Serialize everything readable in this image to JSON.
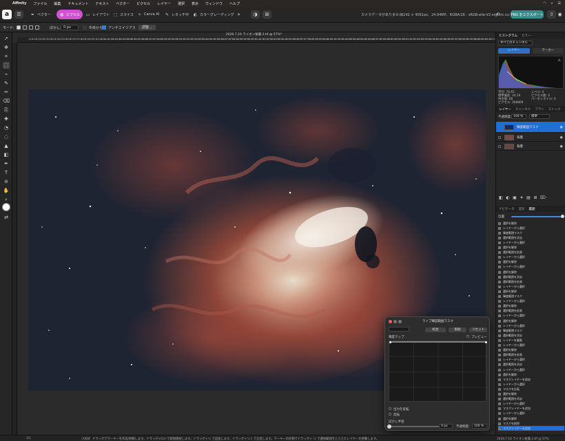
{
  "menubar": {
    "app": "Affinity",
    "items": [
      "ファイル",
      "編集",
      "ドキュメント",
      "テキスト",
      "ベクター",
      "ピクセル",
      "レイヤー",
      "選択",
      "表示",
      "ウィンドウ",
      "ヘルプ"
    ]
  },
  "toolbar": {
    "personas": [
      "ベクター",
      "ピクセル",
      "レイアウト",
      "スライス",
      "Canva AI",
      "レタッチ中",
      "カラーグレーディング"
    ],
    "camera_info": "カメラデータがありません",
    "image_info": "6142 × 4061px、24.94MP、RGBA/16 - sRGB-elle-V2-srgbtrc.icc",
    "export_label": "PNG をエクスポート"
  },
  "context": {
    "mode_label": "モード:",
    "blur_label": "ぼかし:",
    "blur_value": "0 px",
    "center_label": "中央から",
    "antialias_label": "アンチエイリアス",
    "refine_label": "調整..."
  },
  "document": {
    "title": "2026.7.10 ライオン秘書.2.tif @ 57%*"
  },
  "ruler_ticks": [
    "100",
    "150",
    "200",
    "250",
    "300",
    "350",
    "400",
    "450",
    "500",
    "550",
    "600",
    "650",
    "700",
    "750",
    "800",
    "850",
    "900",
    "950",
    "1000",
    "1050",
    "1100",
    "1150",
    "1200",
    "1250",
    "1300",
    "1350",
    "1400",
    "1450",
    "1500",
    "1550",
    "1600",
    "1650",
    "1700",
    "1750",
    "1800",
    "1850",
    "1900",
    "1950",
    "2000",
    "2050",
    "2100",
    "2150",
    "2200",
    "2250",
    "2300",
    "2350",
    "2400",
    "2450",
    "2500",
    "2550",
    "2600",
    "2650",
    "2700",
    "2750",
    "2800",
    "2850",
    "2900",
    "2950",
    "3000",
    "3050",
    "3100",
    "3150",
    "3200",
    "3250",
    "3300",
    "3350",
    "3400",
    "3450",
    "3500",
    "3550",
    "3600",
    "3650",
    "3700",
    "3750",
    "3800",
    "3850",
    "3900",
    "3950",
    "4000",
    "4050",
    "4100",
    "4150",
    "4200",
    "4250",
    "4300",
    "4350",
    "4400",
    "4450",
    "4500",
    "4550",
    "4600",
    "4650",
    "4700",
    "4750",
    "4800",
    "4850",
    "4900",
    "4950",
    "5000",
    "5050",
    "5100",
    "5150",
    "5200",
    "5250",
    "5300",
    "5350",
    "5400",
    "5450",
    "5500",
    "5550",
    "5600",
    "5650",
    "5700",
    "5750",
    "5800",
    "5850",
    "5900",
    "5950",
    "6000",
    "6050",
    "6100",
    "6150",
    "6200"
  ],
  "histogram_panel": {
    "tabs": [
      "ヒストグラム",
      "カラー"
    ],
    "channel_select": "すべてのチャンネル",
    "subtabs": [
      "レイヤー",
      "マーカー"
    ],
    "stats": {
      "mean_label": "平均:",
      "mean": "79.65",
      "stddev_label": "標準偏差:",
      "stddev": "34.29",
      "median_label": "中央値:",
      "median": "68",
      "pixels_label": "ピクセル:",
      "pixels": "368869",
      "level_label": "レベル:",
      "level": "0",
      "count_label": "ピクセル数:",
      "count": "0",
      "percentile_label": "パーセンタイル:",
      "percentile": "0"
    }
  },
  "layers_panel": {
    "tabs": [
      "レイヤー",
      "チャンネル",
      "ブラシ",
      "ストック"
    ],
    "opacity_label": "不透明度:",
    "opacity": "100 %",
    "blend": "標準",
    "layers": [
      {
        "name": "輝度範囲マスク",
        "selected": true
      },
      {
        "name": "背景",
        "selected": false
      },
      {
        "name": "背景",
        "selected": false
      }
    ]
  },
  "history_panel": {
    "tabs": [
      "ナビゲータ",
      "変形",
      "履歴"
    ],
    "position_label": "位置:",
    "items": [
      {
        "label": "選択を解除",
        "selected": false
      },
      {
        "label": "レイヤーから選択",
        "selected": false
      },
      {
        "label": "輝度範囲マスク",
        "selected": false
      },
      {
        "label": "選択範囲を消去",
        "selected": false
      },
      {
        "label": "レイヤーから選択",
        "selected": false
      },
      {
        "label": "選択を解除",
        "selected": false
      },
      {
        "label": "選択範囲を拡張",
        "selected": false
      },
      {
        "label": "レイヤーから選択",
        "selected": false
      },
      {
        "label": "選択を解除",
        "selected": false
      },
      {
        "label": "レイヤーから選択",
        "selected": false
      },
      {
        "label": "選択を解除",
        "selected": false
      },
      {
        "label": "選択範囲を消去",
        "selected": false
      },
      {
        "label": "選択範囲を拡張",
        "selected": false
      },
      {
        "label": "レイヤーから選択",
        "selected": false
      },
      {
        "label": "選択を解除",
        "selected": false
      },
      {
        "label": "輝度範囲マスク",
        "selected": false
      },
      {
        "label": "レイヤーから選択",
        "selected": false
      },
      {
        "label": "選択を解除",
        "selected": false
      },
      {
        "label": "選択範囲を拡張",
        "selected": false
      },
      {
        "label": "レイヤーから選択",
        "selected": false
      },
      {
        "label": "選択を解除",
        "selected": false
      },
      {
        "label": "レイヤーから選択",
        "selected": false
      },
      {
        "label": "輝度範囲マスク",
        "selected": false
      },
      {
        "label": "選択範囲を消去",
        "selected": false
      },
      {
        "label": "レイヤーを複製",
        "selected": false
      },
      {
        "label": "レイヤーから選択",
        "selected": false
      },
      {
        "label": "選択を解除",
        "selected": false
      },
      {
        "label": "選択範囲を拡張",
        "selected": false
      },
      {
        "label": "レイヤーから選択",
        "selected": false
      },
      {
        "label": "選択範囲を消去",
        "selected": false
      },
      {
        "label": "レイヤーから選択",
        "selected": false
      },
      {
        "label": "選択を解除",
        "selected": false
      },
      {
        "label": "マスクレイヤーを追加",
        "selected": false
      },
      {
        "label": "レイヤーから選択",
        "selected": false
      },
      {
        "label": "マスクを反転",
        "selected": false
      },
      {
        "label": "選択を解除",
        "selected": false
      },
      {
        "label": "選択範囲を消去",
        "selected": false
      },
      {
        "label": "レイヤーから選択",
        "selected": false
      },
      {
        "label": "マスクレイヤーを追加",
        "selected": false
      },
      {
        "label": "レイヤーから選択",
        "selected": false
      },
      {
        "label": "選択を解除",
        "selected": false
      },
      {
        "label": "マスクを削除",
        "selected": false
      },
      {
        "label": "マスクレイヤーを追加",
        "selected": true
      }
    ]
  },
  "dialog": {
    "title": "ライブ輝度範囲マスク",
    "merge": "結合",
    "delete": "削除",
    "reset": "リセット",
    "curve_label": "輝度マップ",
    "preview_label": "プレビュー",
    "output_label": "出力を反転",
    "invert_label": "反転",
    "blur_label": "ぼかし半径",
    "blur_value": "0 px",
    "opacity_label": "不透明度:",
    "opacity_value": "100 %"
  },
  "status": {
    "page": "1/1",
    "left": "小形状",
    "hint": "ドラッグでマーキーを作成/移動します。ドラッグ+Ctrl で新規選択します。ドラッグ+⌥ で追加します。ドラッグ+⌥⇧ で交差します。マーキーの外側でドラッグ+ ⌥ で選択範囲をとらえたレイヤーを移動します。",
    "right": "2026.7.10 ライオン秘書.2.tif @ 57%"
  },
  "colors": {
    "accent": "#1f6fd6",
    "persona_active": "#d052d0",
    "export": "#3a8a8a"
  }
}
